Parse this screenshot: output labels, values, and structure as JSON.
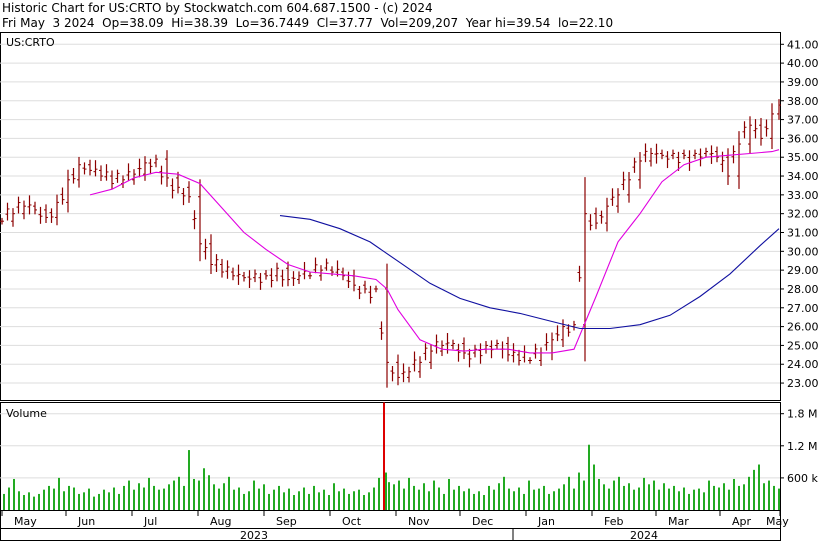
{
  "header": {
    "line1": "Historic Chart for US:CRTO by Stockwatch.com 604.687.1500 - (c) 2024",
    "line2": "Fri May  3 2024  Op=38.09  Hi=38.39  Lo=36.7449  Cl=37.77  Vol=209,207  Year hi=39.54  lo=22.10"
  },
  "colors": {
    "price_bar": "#8b0000",
    "ma_short": "#e000e0",
    "ma_long": "#1010a0",
    "volume_bar": "#22aa22",
    "volume_spike": "#dd0000",
    "grid": "#dddddd"
  },
  "chart_data": [
    {
      "type": "bar",
      "title": "US:CRTO",
      "ylim": [
        22.1,
        41.6
      ],
      "y_ticks": [
        "41.00",
        "40.00",
        "39.00",
        "38.00",
        "37.00",
        "36.00",
        "35.00",
        "34.00",
        "33.00",
        "32.00",
        "31.00",
        "30.00",
        "29.00",
        "28.00",
        "27.00",
        "26.00",
        "25.00",
        "24.00",
        "23.00"
      ],
      "x_ticks": [
        "May",
        "Jun",
        "Jul",
        "Aug",
        "Sep",
        "Oct",
        "Nov",
        "Dec",
        "Jan",
        "Feb",
        "Mar",
        "Apr",
        "May"
      ],
      "years": [
        "2023",
        "2024"
      ],
      "grid": true,
      "series": [
        {
          "x": [
            2,
            13,
            24,
            35,
            46,
            57,
            68,
            79,
            90,
            101,
            112,
            123,
            134,
            145,
            156,
            167,
            178,
            189,
            200,
            211,
            222,
            233,
            244,
            255,
            266,
            277,
            288,
            299,
            310,
            321,
            332,
            343,
            354,
            365,
            376,
            387,
            398,
            409,
            420,
            431,
            442,
            453,
            464,
            475,
            486,
            497,
            508,
            519,
            530,
            541,
            552,
            563,
            574,
            585,
            596,
            607,
            618,
            629,
            640,
            651,
            662,
            673,
            684,
            695,
            706,
            717,
            728,
            739,
            750,
            761,
            772,
            779
          ],
          "values": [
            31.6,
            32.0,
            32.4,
            32.2,
            31.8,
            32.6,
            33.8,
            34.6,
            34.3,
            34.0,
            33.6,
            33.8,
            34.1,
            34.7,
            34.9,
            33.9,
            33.4,
            32.9,
            30.4,
            29.3,
            28.9,
            28.7,
            28.6,
            28.8,
            28.7,
            29.1,
            28.5,
            28.7,
            28.7,
            29.0,
            28.9,
            28.7,
            28.2,
            28.0,
            28.0,
            24.1,
            23.3,
            23.6,
            24.1,
            24.7,
            25.0,
            25.1,
            24.6,
            24.8,
            25.0,
            25.1,
            24.5,
            24.2,
            24.2,
            24.6,
            25.3,
            26.0,
            26.1,
            32.0,
            31.5,
            32.4,
            33.0,
            33.8,
            34.8,
            35.2,
            35.1,
            35.2,
            35.1,
            35.2,
            35.3,
            35.0,
            34.0,
            35.7,
            36.7,
            36.0,
            37.3,
            37.77
          ],
          "name": ""
        },
        {
          "x": [
            90,
            112,
            134,
            156,
            178,
            200,
            222,
            244,
            266,
            288,
            310,
            332,
            354,
            376,
            387,
            398,
            420,
            442,
            464,
            486,
            508,
            530,
            552,
            574,
            596,
            618,
            640,
            662,
            684,
            706,
            728,
            750,
            772,
            779
          ],
          "values": [
            33.0,
            33.3,
            33.9,
            34.2,
            34.1,
            33.6,
            32.3,
            31.0,
            30.1,
            29.3,
            28.9,
            28.8,
            28.7,
            28.5,
            28.0,
            26.9,
            25.3,
            24.8,
            24.7,
            24.8,
            24.8,
            24.6,
            24.6,
            24.8,
            27.6,
            30.5,
            32.0,
            33.7,
            34.6,
            35.0,
            35.1,
            35.2,
            35.3,
            35.4
          ],
          "name": ""
        },
        {
          "x": [
            280,
            310,
            340,
            370,
            400,
            430,
            460,
            490,
            520,
            550,
            580,
            610,
            640,
            670,
            700,
            730,
            760,
            779
          ],
          "values": [
            31.9,
            31.7,
            31.2,
            30.5,
            29.4,
            28.3,
            27.5,
            27.0,
            26.7,
            26.3,
            25.9,
            25.9,
            26.1,
            26.6,
            27.6,
            28.8,
            30.3,
            31.2
          ],
          "name": ""
        }
      ]
    },
    {
      "type": "bar",
      "title": "Volume",
      "ylim": [
        0,
        2.0
      ],
      "y_ticks": [
        "1.8 M",
        "1.2 M",
        "600 k"
      ],
      "x": [
        4,
        9,
        14,
        19,
        24,
        29,
        34,
        39,
        44,
        49,
        54,
        59,
        64,
        69,
        74,
        79,
        84,
        89,
        94,
        99,
        104,
        109,
        114,
        119,
        124,
        129,
        134,
        139,
        144,
        149,
        154,
        159,
        164,
        169,
        174,
        179,
        184,
        189,
        194,
        199,
        204,
        209,
        214,
        219,
        224,
        229,
        234,
        239,
        244,
        249,
        254,
        259,
        264,
        269,
        274,
        279,
        284,
        289,
        294,
        299,
        304,
        309,
        314,
        319,
        324,
        329,
        334,
        339,
        344,
        349,
        354,
        359,
        364,
        369,
        374,
        379,
        384,
        386,
        389,
        394,
        399,
        404,
        409,
        414,
        419,
        424,
        429,
        434,
        439,
        444,
        449,
        454,
        459,
        464,
        469,
        474,
        479,
        484,
        489,
        494,
        499,
        504,
        509,
        514,
        519,
        524,
        529,
        534,
        539,
        544,
        549,
        554,
        559,
        564,
        569,
        574,
        579,
        584,
        589,
        594,
        599,
        604,
        609,
        614,
        619,
        624,
        629,
        634,
        639,
        644,
        649,
        654,
        659,
        664,
        669,
        674,
        679,
        684,
        689,
        694,
        699,
        704,
        709,
        714,
        719,
        724,
        729,
        734,
        739,
        744,
        749,
        754,
        759,
        764,
        769,
        774,
        779
      ],
      "values": [
        0.3,
        0.42,
        0.58,
        0.35,
        0.28,
        0.33,
        0.25,
        0.3,
        0.38,
        0.45,
        0.4,
        0.6,
        0.35,
        0.45,
        0.42,
        0.3,
        0.33,
        0.4,
        0.25,
        0.3,
        0.38,
        0.33,
        0.42,
        0.3,
        0.45,
        0.55,
        0.38,
        0.5,
        0.42,
        0.6,
        0.45,
        0.38,
        0.4,
        0.48,
        0.55,
        0.62,
        0.45,
        1.12,
        0.58,
        0.55,
        0.78,
        0.65,
        0.48,
        0.4,
        0.5,
        0.62,
        0.38,
        0.42,
        0.3,
        0.35,
        0.55,
        0.4,
        0.48,
        0.3,
        0.38,
        0.45,
        0.33,
        0.4,
        0.28,
        0.35,
        0.42,
        0.3,
        0.45,
        0.33,
        0.38,
        0.28,
        0.5,
        0.35,
        0.4,
        0.3,
        0.35,
        0.38,
        0.28,
        0.33,
        0.42,
        0.6,
        2.01,
        0.7,
        0.52,
        0.48,
        0.55,
        0.4,
        0.6,
        0.45,
        0.38,
        0.5,
        0.35,
        0.55,
        0.42,
        0.3,
        0.58,
        0.38,
        0.45,
        0.35,
        0.4,
        0.3,
        0.35,
        0.28,
        0.45,
        0.38,
        0.5,
        0.62,
        0.4,
        0.35,
        0.42,
        0.3,
        0.55,
        0.38,
        0.4,
        0.45,
        0.3,
        0.35,
        0.4,
        0.48,
        0.62,
        0.4,
        0.7,
        0.55,
        1.22,
        0.85,
        0.58,
        0.48,
        0.4,
        0.55,
        0.62,
        0.45,
        0.5,
        0.38,
        0.42,
        0.6,
        0.48,
        0.55,
        0.38,
        0.5,
        0.4,
        0.45,
        0.35,
        0.42,
        0.3,
        0.38,
        0.4,
        0.33,
        0.55,
        0.45,
        0.42,
        0.5,
        0.38,
        0.58,
        0.45,
        0.48,
        0.62,
        0.75,
        0.85,
        0.5,
        0.55,
        0.45,
        0.4
      ]
    }
  ]
}
